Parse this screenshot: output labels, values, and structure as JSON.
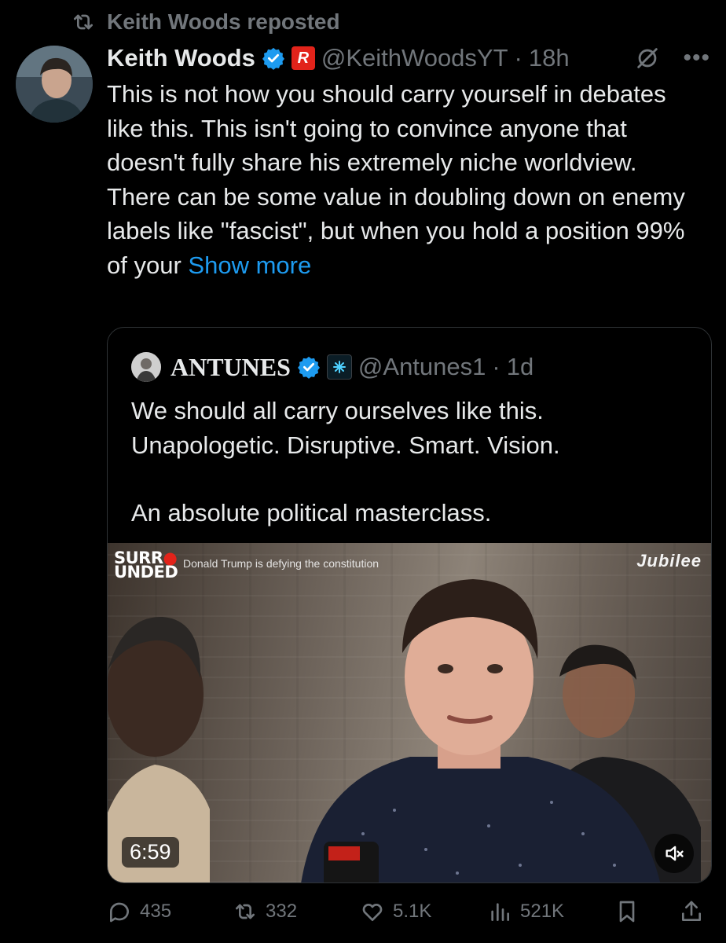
{
  "repost_banner": {
    "text": "Keith Woods reposted",
    "icon": "repost-icon"
  },
  "post": {
    "author_name": "Keith Woods",
    "handle": "@KeithWoodsYT",
    "separator": "·",
    "time": "18h",
    "org_badge": "R",
    "body_lines": [
      "This is not how you should carry yourself in debates like this. This isn't going to convince anyone that doesn't fully share his extremely niche worldview.",
      "There can be some value in doubling down on enemy labels like \"fascist\", but when you hold a position 99% of your"
    ],
    "show_more": "Show more"
  },
  "quote": {
    "author_name": "ANTUNES",
    "handle": "@Antunes1",
    "separator": "·",
    "time": "1d",
    "lines": [
      "We should all carry ourselves like this.",
      "Unapologetic. Disruptive. Smart. Vision.",
      "An absolute political masterclass."
    ],
    "video": {
      "brand_top": "SURR",
      "brand_bottom": "UNDED",
      "caption": "Donald Trump is defying the constitution",
      "channel": "Jubilee",
      "duration": "6:59"
    }
  },
  "actions": {
    "replies": "435",
    "reposts": "332",
    "likes": "5.1K",
    "views": "521K"
  },
  "colors": {
    "background": "#000000",
    "text": "#e7e9ea",
    "muted": "#71767b",
    "link": "#1d9bf0",
    "verified": "#1d9bf0",
    "badge_red": "#e2231a"
  }
}
